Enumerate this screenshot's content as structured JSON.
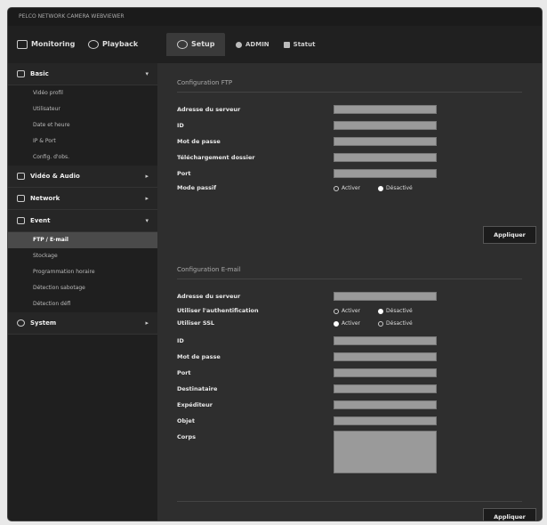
{
  "titlebar": {
    "text": "PELCO NETWORK CAMERA WEBVIEWER"
  },
  "topnav": {
    "monitoring": "Monitoring",
    "playback": "Playback",
    "setup": "Setup",
    "admin": "ADMIN",
    "status": "Statut"
  },
  "sidebar": {
    "basic": "Basic",
    "basic_items": [
      "Vidéo profil",
      "Utilisateur",
      "Date et heure",
      "IP & Port",
      "Config. d'obs."
    ],
    "video_audio": "Vidéo & Audio",
    "network": "Network",
    "event": "Event",
    "event_items": [
      "FTP / E-mail",
      "Stockage",
      "Programmation horaire",
      "Détection sabotage",
      "Détection défl"
    ],
    "system": "System"
  },
  "ftp": {
    "title": "Configuration FTP",
    "server_label": "Adresse du serveur",
    "id_label": "ID",
    "password_label": "Mot de passe",
    "dir_label": "Téléchargement dossier",
    "port_label": "Port",
    "passive_label": "Mode passif",
    "on": "Activer",
    "off": "Désactivé",
    "apply": "Appliquer"
  },
  "email": {
    "title": "Configuration E-mail",
    "server_label": "Adresse du serveur",
    "auth_label": "Utiliser l'authentification",
    "ssl_label": "Utiliser SSL",
    "auth_on": "Activer",
    "auth_off": "Désactivé",
    "ssl_on": "Activer",
    "ssl_off": "Désactivé",
    "id_label": "ID",
    "password_label": "Mot de passe",
    "port_label": "Port",
    "to_label": "Destinataire",
    "from_label": "Expéditeur",
    "subject_label": "Objet",
    "body_label": "Corps",
    "apply": "Appliquer"
  }
}
